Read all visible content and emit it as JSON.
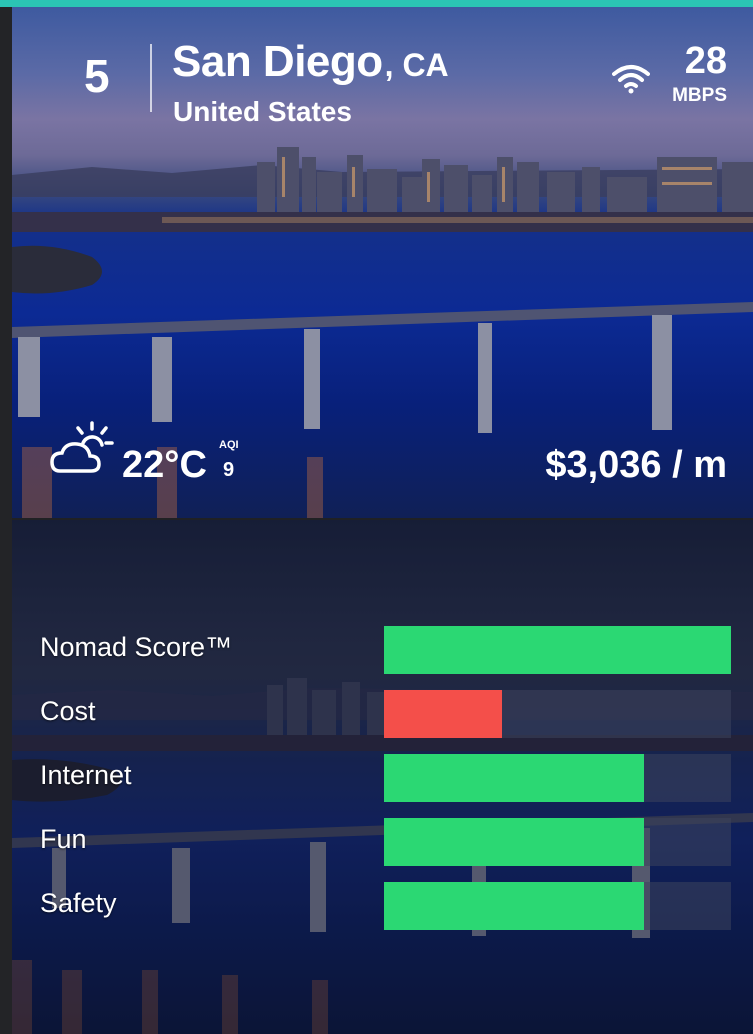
{
  "header": {
    "rank": "5",
    "city": "San Diego",
    "state": ", CA",
    "country": "United States",
    "internet_speed": "28",
    "internet_unit": "MBPS"
  },
  "conditions": {
    "temperature": "22°C",
    "aqi_label": "AQI",
    "aqi_value": "9",
    "monthly_cost": "$3,036 / m"
  },
  "icons": [
    "wifi-icon",
    "partly-sunny-icon"
  ],
  "scores": [
    {
      "label": "Nomad Score™",
      "fraction": 1.0,
      "color": "#2bd873"
    },
    {
      "label": "Cost",
      "fraction": 0.34,
      "color": "#f44f4a"
    },
    {
      "label": "Internet",
      "fraction": 0.75,
      "color": "#2bd873"
    },
    {
      "label": "Fun",
      "fraction": 0.75,
      "color": "#2bd873"
    },
    {
      "label": "Safety",
      "fraction": 0.75,
      "color": "#2bd873"
    }
  ],
  "colors": {
    "accent": "#2bc5b4",
    "good": "#2bd873",
    "bad": "#f44f4a"
  }
}
